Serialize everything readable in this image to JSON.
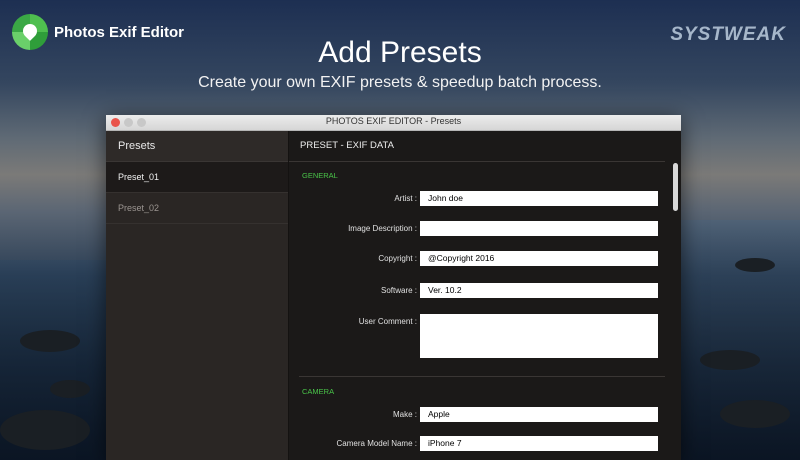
{
  "app": {
    "logo_text": "Photos Exif Editor",
    "brand": "SYSTWEAK"
  },
  "hero": {
    "title": "Add Presets",
    "subtitle": "Create your own EXIF presets & speedup batch process."
  },
  "window": {
    "title": "PHOTOS EXIF EDITOR - Presets"
  },
  "sidebar": {
    "header": "Presets",
    "items": [
      {
        "label": "Preset_01",
        "selected": true
      },
      {
        "label": "Preset_02",
        "selected": false
      }
    ]
  },
  "main": {
    "header": "PRESET - EXIF DATA",
    "general": {
      "title": "GENERAL",
      "artist_label": "Artist :",
      "artist_value": "John doe",
      "image_description_label": "Image Description :",
      "image_description_value": "",
      "copyright_label": "Copyright :",
      "copyright_value": "@Copyright 2016",
      "software_label": "Software :",
      "software_value": "Ver. 10.2",
      "user_comment_label": "User Comment :",
      "user_comment_value": ""
    },
    "camera": {
      "title": "CAMERA",
      "make_label": "Make :",
      "make_value": "Apple",
      "model_label": "Camera Model Name :",
      "model_value": "iPhone 7"
    }
  },
  "colors": {
    "accent_green": "#49c449",
    "close_button": "#e9544b"
  }
}
